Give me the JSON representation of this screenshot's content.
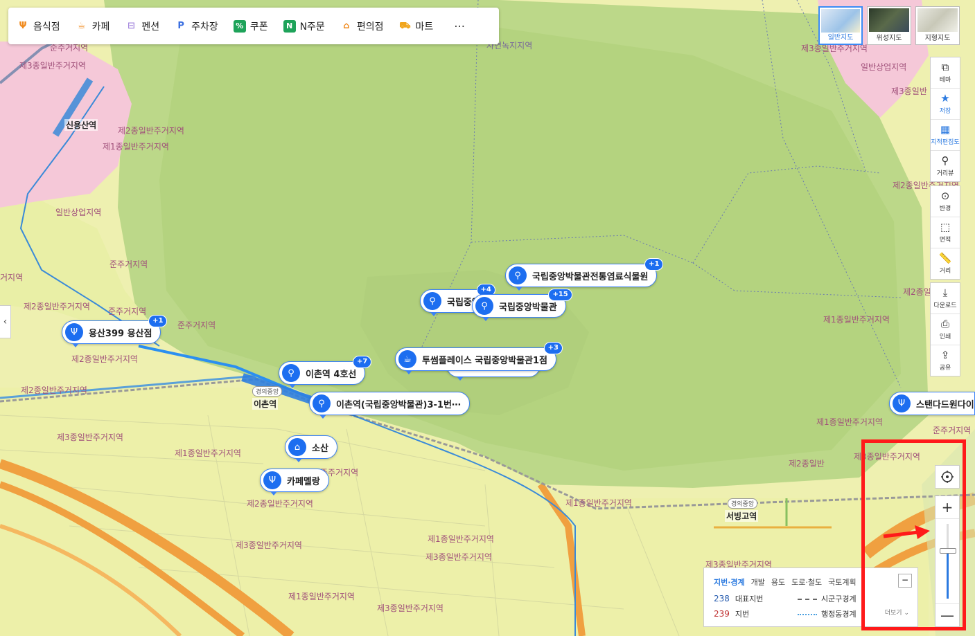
{
  "categories": [
    {
      "label": "음식점",
      "icon": "fork-knife-icon",
      "color": "#f08a1d"
    },
    {
      "label": "카페",
      "icon": "coffee-cup-icon",
      "color": "#f08a1d"
    },
    {
      "label": "펜션",
      "icon": "bed-icon",
      "color": "#a78bdf"
    },
    {
      "label": "주차장",
      "icon": "parking-icon",
      "color": "#3b6fe0"
    },
    {
      "label": "쿠폰",
      "icon": "percent-icon",
      "color": "#1ea35a"
    },
    {
      "label": "N주문",
      "icon": "order-bag-icon",
      "color": "#1ea35a"
    },
    {
      "label": "편의점",
      "icon": "store-icon",
      "color": "#f08a1d"
    },
    {
      "label": "마트",
      "icon": "cart-icon",
      "color": "#f0a51d"
    }
  ],
  "more_label": "⋯",
  "map_types": [
    {
      "label": "일반지도",
      "active": true
    },
    {
      "label": "위성지도",
      "active": false
    },
    {
      "label": "지형지도",
      "active": false
    }
  ],
  "tools_top": [
    {
      "label": "테마",
      "icon": "layers-icon",
      "glyph": "⧉"
    },
    {
      "label": "저장",
      "icon": "star-icon",
      "glyph": "★"
    },
    {
      "label": "지적편집도",
      "icon": "grid-icon",
      "glyph": "▦"
    },
    {
      "label": "거리뷰",
      "icon": "map-pin-icon",
      "glyph": "⚲"
    }
  ],
  "tools_mid": [
    {
      "label": "반경",
      "icon": "radius-icon",
      "glyph": "⊙"
    },
    {
      "label": "면적",
      "icon": "area-icon",
      "glyph": "⬚"
    },
    {
      "label": "거리",
      "icon": "ruler-icon",
      "glyph": "📏"
    }
  ],
  "tools_bottom": [
    {
      "label": "다운로드",
      "icon": "download-icon",
      "glyph": "⤓"
    },
    {
      "label": "인쇄",
      "icon": "print-icon",
      "glyph": "⎙"
    },
    {
      "label": "공유",
      "icon": "share-icon",
      "glyph": "⇪"
    }
  ],
  "markers": [
    {
      "name": "국립중앙박물관전통염료식물원",
      "badge": "+1",
      "icon": "map-pin-icon"
    },
    {
      "name": "국립중앙",
      "badge": "+4",
      "icon": "map-pin-icon"
    },
    {
      "name": "국립중앙박물관",
      "badge": "+15",
      "icon": "map-pin-icon"
    },
    {
      "name": "용산399 용산점",
      "badge": "+1",
      "icon": "fork-knife-icon"
    },
    {
      "name": "투썸플레이스 국립중앙박물관1점",
      "badge": "+3",
      "icon": "coffee-cup-icon"
    },
    {
      "name": "못",
      "badge": "+1",
      "icon": "map-pin-icon"
    },
    {
      "name": "이촌역 4호선",
      "badge": "+7",
      "icon": "map-pin-icon"
    },
    {
      "name": "이촌역(국립중앙박물관)3-1번⋯",
      "badge": "",
      "icon": "map-pin-icon"
    },
    {
      "name": "소산",
      "badge": "",
      "icon": "store-icon"
    },
    {
      "name": "카페멜랑",
      "badge": "",
      "icon": "fork-knife-icon"
    },
    {
      "name": "스탠다드원다이닝",
      "badge": "",
      "icon": "fork-knife-icon"
    }
  ],
  "zone_labels": {
    "z1": "준주거지역",
    "z2": "제3종일반주거지역",
    "z3": "제2종일반주거지역",
    "z4": "제1종일반주거지역",
    "z5": "일반상업지역",
    "z6": "준주거지역",
    "z7": "거지역",
    "z8": "제2종일반주거지역",
    "z9": "준주거지역",
    "z10": "준주거지역",
    "z11": "제2종일반주거지역",
    "z12": "제2종일반주거지역",
    "z13": "제3종일반주거지역",
    "z14": "제1종일반주거지역",
    "z15": "준주거지역",
    "z16": "제2종일반주거지역",
    "z17": "제3종일반주거지역",
    "z18": "제1종일반주거지역",
    "z19": "제3종일반주거지역",
    "z20": "제1종일반주거지역",
    "z21": "제3종일반주거지역",
    "z22": "자연녹지지역",
    "z23": "제1종일반주거지역",
    "z24": "제3종일반주거지역",
    "z25": "일반상업지역",
    "z26": "제3종일반",
    "z27": "제2종일반주거지역",
    "z28": "제2종일",
    "z29": "제1종일반주거지역",
    "z30": "제1종일반주거지역",
    "z31": "준주거지역",
    "z32": "제2종일반",
    "z33": "제3종일반주거지역",
    "z34": "제3종일반주거지역",
    "z35": "제1종일반주거지역",
    "z36": "제3종일반주거지역"
  },
  "stations": {
    "sinyongsan": "신용산역",
    "ichon": "이촌역",
    "seobinggo": "서빙고역",
    "gyeongui1": "경의중앙",
    "gyeongui2": "경의중앙"
  },
  "legend": {
    "tabs": [
      "지번·경계",
      "개발",
      "용도",
      "도로·철도",
      "국토계획"
    ],
    "active_tab": "지번·경계",
    "row1_num": "238",
    "row1_label": "대표지번",
    "row2_num": "239",
    "row2_label": "지번",
    "boundary1": "시군구경계",
    "boundary2": "행정동경계",
    "more": "더보기",
    "collapse": "−"
  },
  "zoom": {
    "level_fraction": 0.65,
    "plus": "+",
    "minus": "—"
  },
  "side_toggle": "‹",
  "colors": {
    "accent": "#2b7ae0",
    "annotation": "#ff1a1a",
    "park": "#b8d58a",
    "residential": "#ecefa8",
    "commercial": "#f5c7d6"
  }
}
